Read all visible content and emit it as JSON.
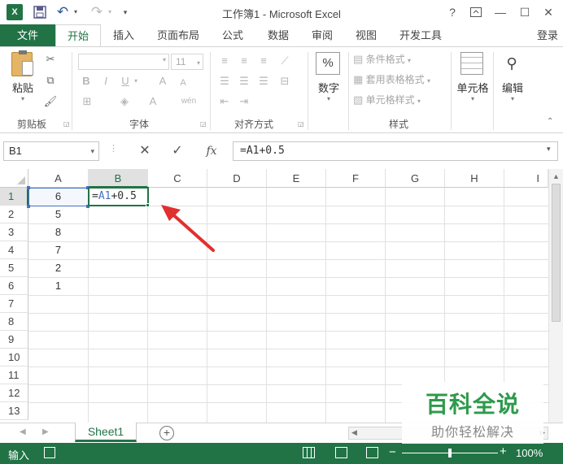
{
  "title": "工作簿1 - Microsoft Excel",
  "qat": {
    "excel_icon": "excel-logo-icon",
    "save": "save-icon",
    "undo": "undo-icon",
    "redo": "redo-icon"
  },
  "window": {
    "help": "?",
    "restore_ribbon": "ribbon-display-icon",
    "minimize": "minimize-icon",
    "maximize": "maximize-icon",
    "close": "close-icon"
  },
  "tabs": [
    "文件",
    "开始",
    "插入",
    "页面布局",
    "公式",
    "数据",
    "审阅",
    "视图",
    "开发工具"
  ],
  "login": "登录",
  "ribbon": {
    "clipboard": {
      "paste": "粘贴",
      "label": "剪贴板"
    },
    "font": {
      "name": "",
      "size": "11",
      "bold": "B",
      "italic": "I",
      "underline": "U",
      "grow": "A",
      "shrink": "A",
      "color": "A",
      "phonetic": "wén",
      "label": "字体"
    },
    "alignment": {
      "label": "对齐方式"
    },
    "number": {
      "btn": "数字",
      "icon": "%"
    },
    "styles": {
      "conditional": "条件格式",
      "table": "套用表格格式",
      "cell": "单元格样式",
      "label": "样式"
    },
    "cells": {
      "btn": "单元格"
    },
    "editing": {
      "btn": "编辑"
    }
  },
  "formula_bar": {
    "name_box": "B1",
    "cancel": "✕",
    "enter": "✓",
    "fx": "fx",
    "formula": "=A1+0.5"
  },
  "grid": {
    "columns": [
      "A",
      "B",
      "C",
      "D",
      "E",
      "F",
      "G",
      "H",
      "I"
    ],
    "rows": [
      "1",
      "2",
      "3",
      "4",
      "5",
      "6",
      "7",
      "8",
      "9",
      "10",
      "11",
      "12",
      "13"
    ],
    "col_a_values": [
      "6",
      "5",
      "8",
      "7",
      "2",
      "1"
    ],
    "b1_edit": {
      "eq": "=",
      "ref": "A1",
      "rest": "+0.5"
    }
  },
  "sheet": {
    "tab": "Sheet1",
    "add": "+"
  },
  "status": {
    "mode": "输入",
    "zoom": "100%"
  },
  "watermark": {
    "brand": "百科全说",
    "sub": "助你轻松解决"
  },
  "colors": {
    "excel_green": "#217346",
    "ref_blue": "#4472c4",
    "arrow_red": "#e03030"
  }
}
